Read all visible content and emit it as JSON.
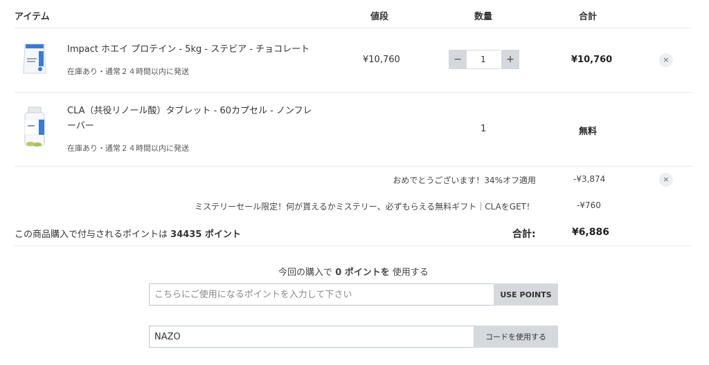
{
  "table_header": {
    "item": "アイテム",
    "price": "値段",
    "quantity": "数量",
    "total": "合計"
  },
  "items": [
    {
      "name": "Impact ホエイ プロテイン - 5kg - ステビア - チョコレート",
      "stock": "在庫あり・通常２４時間以内に発送",
      "price": "¥10,760",
      "quantity": "1",
      "total": "¥10,760",
      "remove": "×"
    },
    {
      "name": "CLA（共役リノール酸）タブレット - 60カプセル - ノンフレーバー",
      "stock": "在庫あり・通常２４時間以内に発送",
      "quantity": "1",
      "total": "無料"
    }
  ],
  "quantity_controls": {
    "decrement": "−",
    "increment": "+"
  },
  "discounts": [
    {
      "label": "おめでとうございます！34%オフ適用",
      "amount": "-¥3,874",
      "remove": "×"
    },
    {
      "label": "ミステリーセール限定！何が貰えるかミステリー、必ずもらえる無料ギフト｜CLAをGET！",
      "amount": "-¥760"
    }
  ],
  "points": {
    "earned_prefix": "この商品購入で付与されるポイントは",
    "earned_value": "34435 ポイント"
  },
  "summary": {
    "total_label": "合計:",
    "total_value": "¥6,886"
  },
  "use_points": {
    "prefix": "今回の購入で",
    "value": "0 ポイントを",
    "suffix": "使用する",
    "placeholder": "こちらにご使用になるポイントを入力して下さい",
    "button": "USE POINTS"
  },
  "coupon": {
    "value": "NAZO",
    "button": "コードを使用する"
  },
  "colors": {
    "button_grey": "#d5d8dc",
    "input_border": "#b9c4cc",
    "product_blue": "#3a7bd5"
  }
}
